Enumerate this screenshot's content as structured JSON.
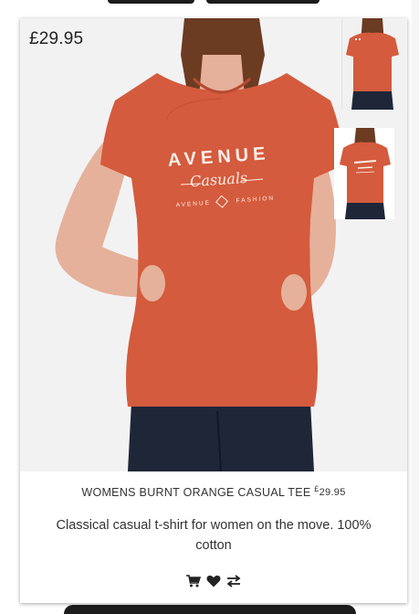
{
  "product": {
    "price_badge": "£29.95",
    "name": "WOMENS BURNT ORANGE CASUAL TEE",
    "inline_price_symbol": "£",
    "inline_price_value": "29.95",
    "description": "Classical casual t-shirt for women on the move. 100% cotton",
    "print_text": {
      "line1": "AVENUE",
      "line2": "Casuals",
      "line3_left": "AVENUE",
      "line3_right": "FASHION"
    }
  },
  "colors": {
    "shirt": "#d45b3d",
    "jeans": "#1e2638",
    "skin": "#e5b19a",
    "hair": "#6b3b22"
  },
  "actions": [
    {
      "icon": "cart-icon"
    },
    {
      "icon": "heart-icon"
    },
    {
      "icon": "compare-icon"
    }
  ]
}
